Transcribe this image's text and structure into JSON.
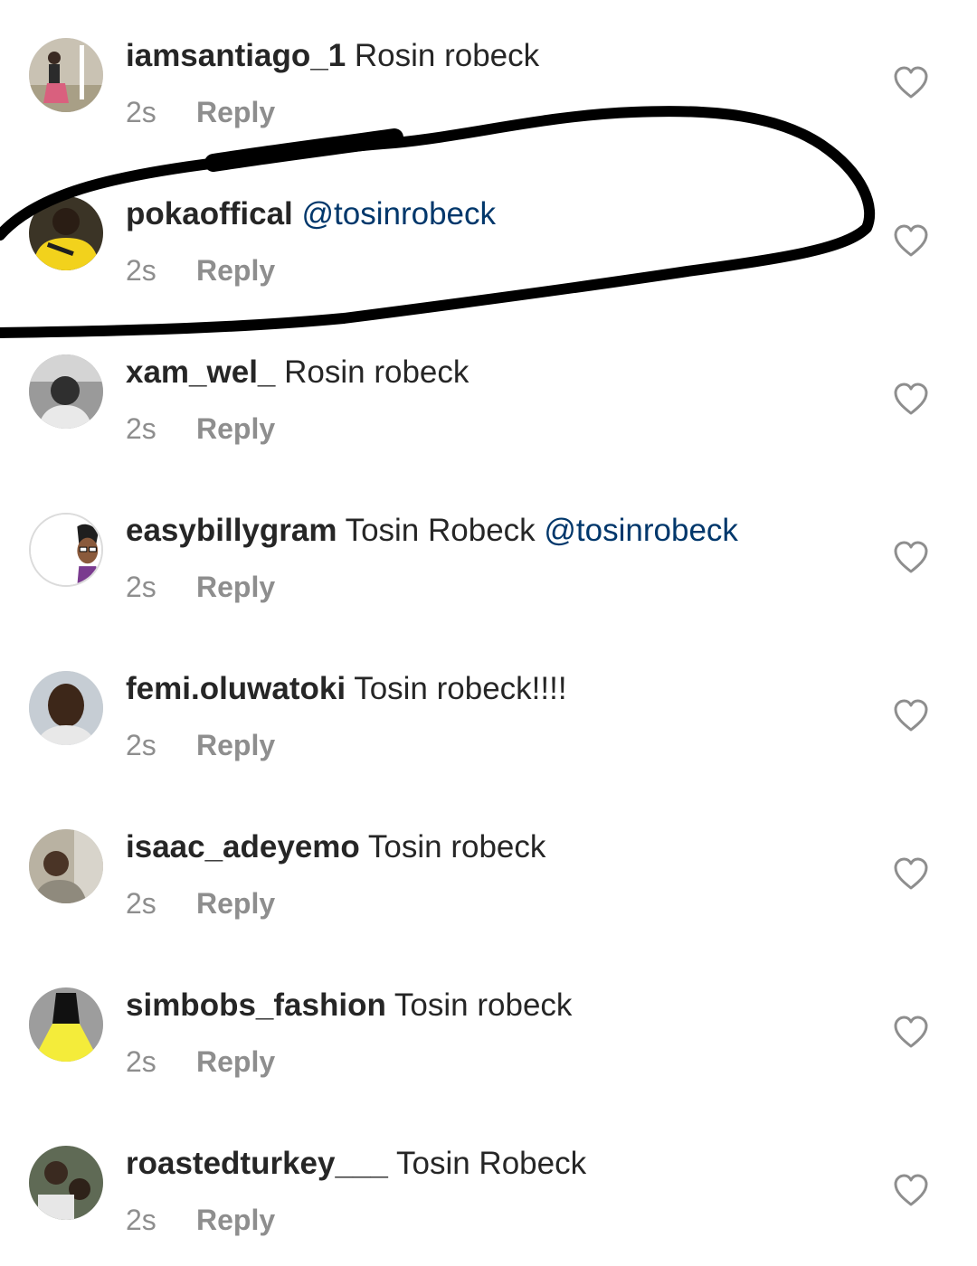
{
  "comments": [
    {
      "username": "iamsantiago_1",
      "text": "Rosin robeck",
      "mention": "",
      "time": "2s",
      "reply": "Reply",
      "avatar_icon": "user-photo-avatar"
    },
    {
      "username": "pokaoffical",
      "text": "",
      "mention": "@tosinrobeck",
      "time": "2s",
      "reply": "Reply",
      "avatar_icon": "user-photo-avatar"
    },
    {
      "username": "xam_wel_",
      "text": "Rosin robeck",
      "mention": "",
      "time": "2s",
      "reply": "Reply",
      "avatar_icon": "user-photo-avatar"
    },
    {
      "username": "easybillygram",
      "text": "Tosin Robeck",
      "mention": "@tosinrobeck",
      "time": "2s",
      "reply": "Reply",
      "avatar_icon": "cartoon-avatar"
    },
    {
      "username": "femi.oluwatoki",
      "text": "Tosin robeck!!!!",
      "mention": "",
      "time": "2s",
      "reply": "Reply",
      "avatar_icon": "user-photo-avatar"
    },
    {
      "username": "isaac_adeyemo",
      "text": "Tosin robeck",
      "mention": "",
      "time": "2s",
      "reply": "Reply",
      "avatar_icon": "user-photo-avatar"
    },
    {
      "username": "simbobs_fashion",
      "text": "Tosin robeck",
      "mention": "",
      "time": "2s",
      "reply": "Reply",
      "avatar_icon": "dress-photo-avatar"
    },
    {
      "username": "roastedturkey___",
      "text": "Tosin Robeck",
      "mention": "",
      "time": "2s",
      "reply": "Reply",
      "avatar_icon": "user-photo-avatar"
    }
  ],
  "icons": {
    "like": "heart-outline-icon"
  },
  "colors": {
    "text": "#262626",
    "secondary_text": "#8e8e8e",
    "mention": "#00376b",
    "like_icon": "#8e8e8e",
    "annotation_marker": "#000000"
  }
}
